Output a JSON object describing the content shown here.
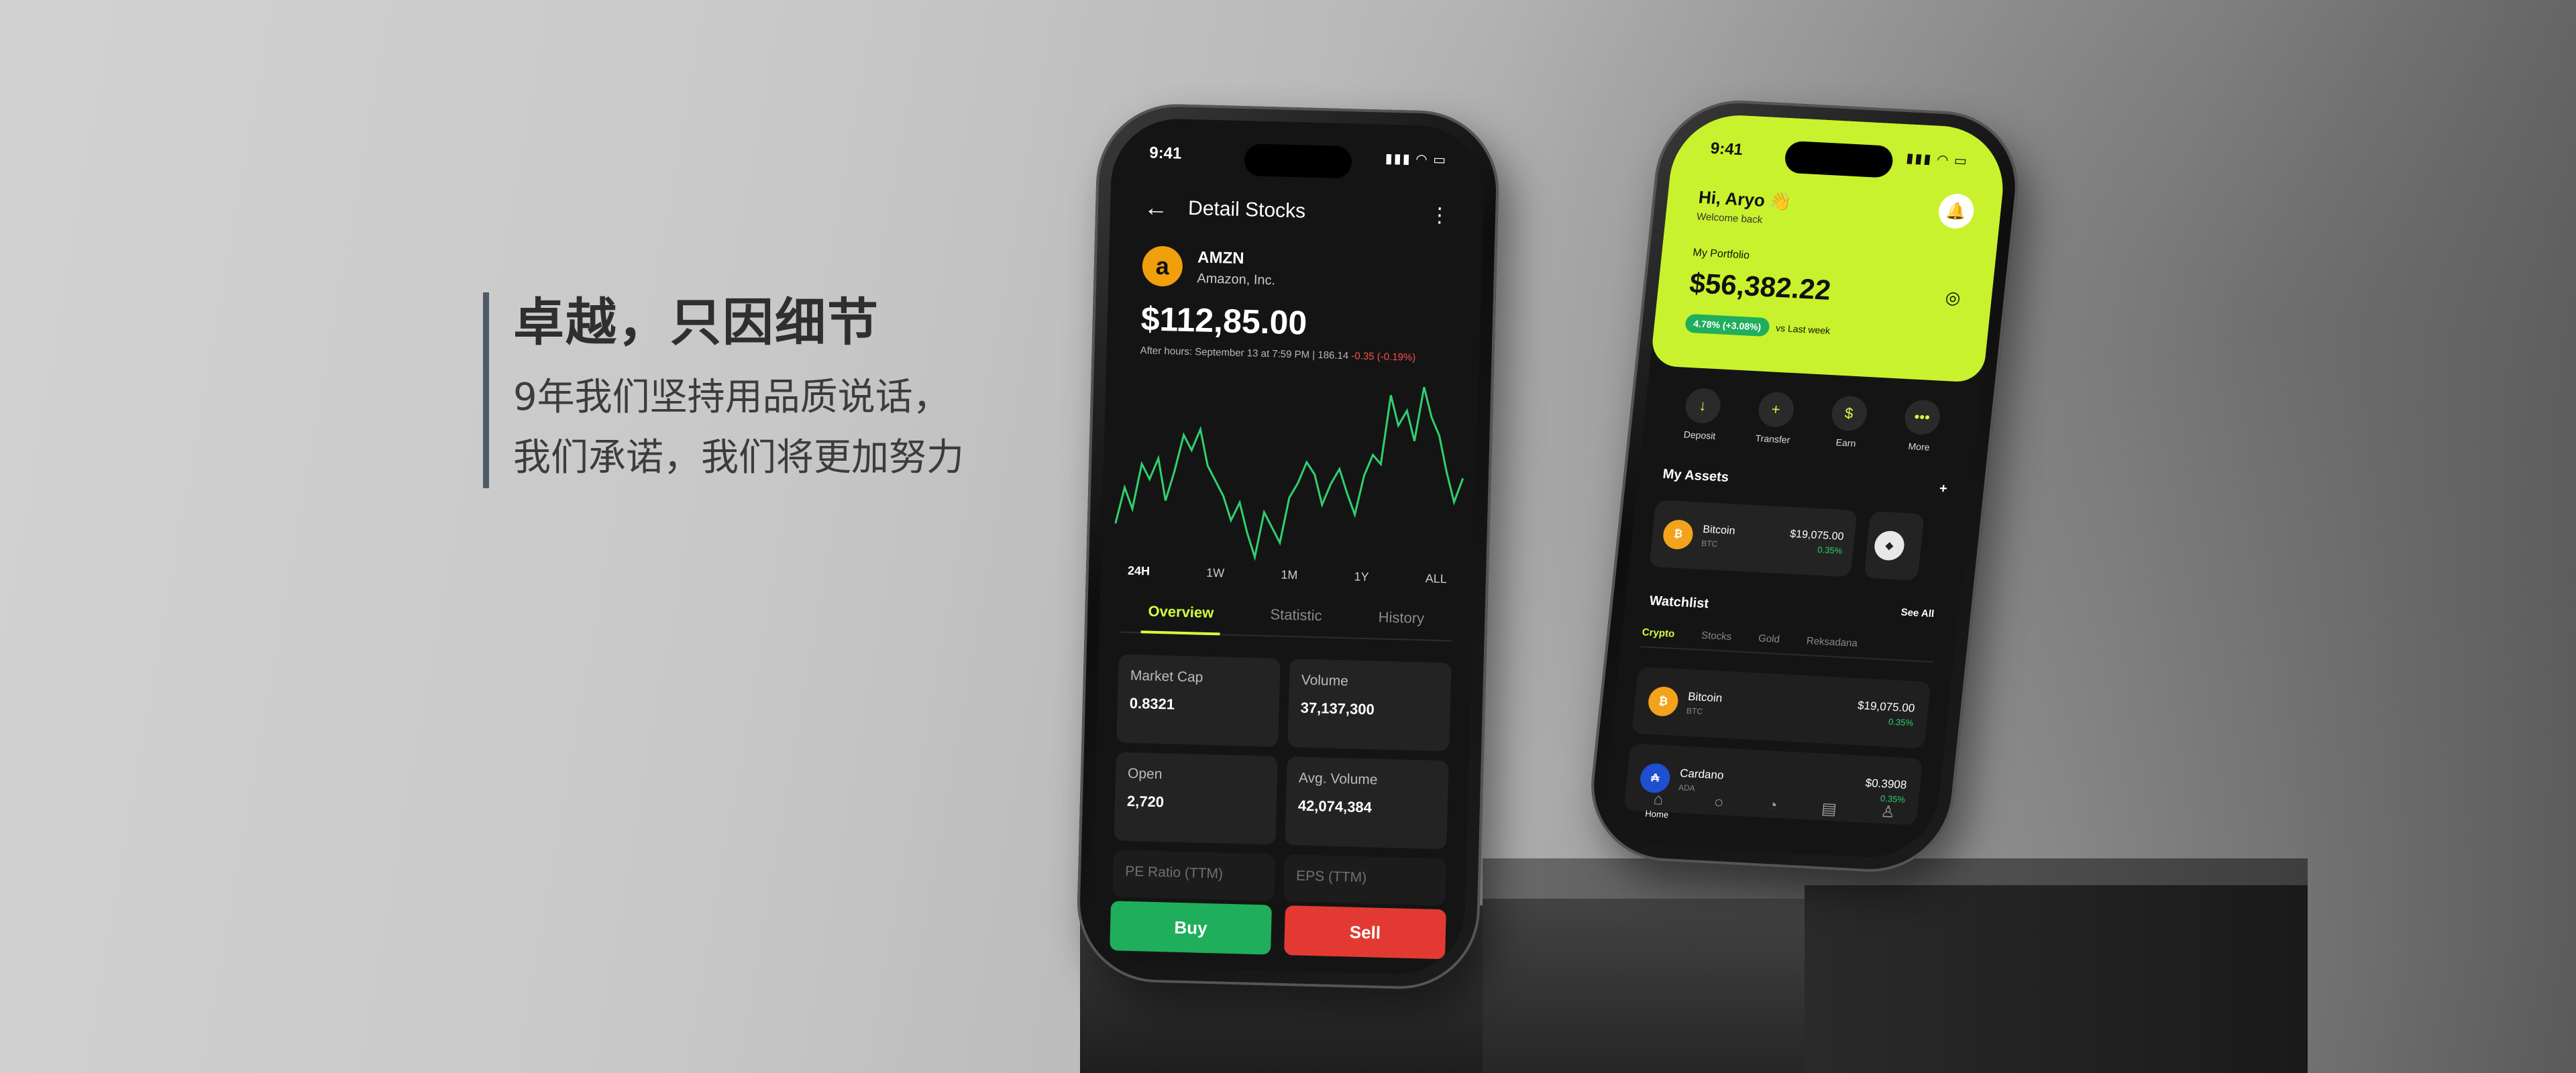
{
  "headline": {
    "title": "卓越，只因细节",
    "line1": "9年我们坚持用品质说话，",
    "line2": "我们承诺，我们将更加努力"
  },
  "phone_stock": {
    "status_time": "9:41",
    "header_title": "Detail Stocks",
    "ticker_symbol": "AMZN",
    "ticker_name": "Amazon, Inc.",
    "price": "$112,85.00",
    "after_hours_text": "After hours: September 13 at 7:59 PM | 186.14",
    "after_hours_change": "-0.35 (-0.19%)",
    "ranges": [
      "24H",
      "1W",
      "1M",
      "1Y",
      "ALL"
    ],
    "tabs": [
      "Overview",
      "Statistic",
      "History"
    ],
    "stats": [
      {
        "label": "Market Cap",
        "value": "0.8321"
      },
      {
        "label": "Volume",
        "value": "37,137,300"
      },
      {
        "label": "Open",
        "value": "2,720"
      },
      {
        "label": "Avg. Volume",
        "value": "42,074,384"
      },
      {
        "label": "PE Ratio (TTM)",
        "value": ""
      },
      {
        "label": "EPS (TTM)",
        "value": ""
      }
    ],
    "buy_label": "Buy",
    "sell_label": "Sell",
    "line_color": "#2fd06f"
  },
  "phone_crypto": {
    "status_time": "9:41",
    "greeting": "Hi, Aryo 👋",
    "welcome": "Welcome back",
    "portfolio_label": "My Portfolio",
    "portfolio_value": "$56,382.22",
    "portfolio_change": "4.78% (+3.08%)",
    "portfolio_change_note": "vs Last week",
    "actions": [
      "Deposit",
      "Transfer",
      "Earn",
      "More"
    ],
    "assets_title": "My Assets",
    "asset_btc": {
      "name": "Bitcoin",
      "symbol": "BTC",
      "value": "$19,075.00",
      "change": "0.35%"
    },
    "watchlist_title": "Watchlist",
    "see_all": "See All",
    "watch_tabs": [
      "Crypto",
      "Stocks",
      "Gold",
      "Reksadana"
    ],
    "watch_rows": [
      {
        "name": "Bitcoin",
        "symbol": "BTC",
        "value": "$19,075.00",
        "change": "0.35%"
      },
      {
        "name": "Cardano",
        "symbol": "ADA",
        "value": "$0.3908",
        "change": "0.35%"
      }
    ],
    "nav_home": "Home",
    "accent": "#c8f22d"
  },
  "chart_data": {
    "type": "line",
    "title": "",
    "xlabel": "",
    "ylabel": "",
    "series": [
      {
        "values": [
          40,
          52,
          45,
          60,
          55,
          62,
          48,
          58,
          70,
          65,
          72,
          60,
          55,
          50,
          42,
          48,
          38,
          30,
          45,
          40,
          35,
          50,
          55,
          62,
          58,
          48,
          55,
          60,
          52,
          45,
          58,
          65,
          62,
          85,
          75,
          80,
          70,
          88,
          78,
          72,
          60,
          50,
          58
        ]
      }
    ]
  }
}
